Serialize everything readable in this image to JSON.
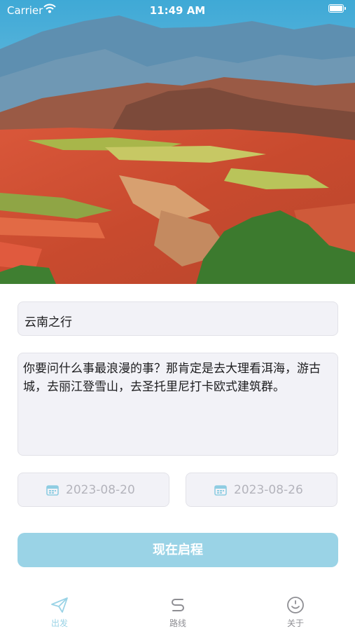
{
  "status_bar": {
    "carrier": "Carrier",
    "time": "11:49 AM"
  },
  "form": {
    "title_value": "云南之行",
    "description_value": "你要问什么事最浪漫的事？那肯定是去大理看洱海，游古城，去丽江登雪山，去圣托里尼打卡欧式建筑群。",
    "start_date": "2023-08-20",
    "end_date": "2023-08-26",
    "submit_label": "现在启程"
  },
  "tabbar": {
    "items": [
      {
        "label": "出发",
        "icon": "paper-plane-icon",
        "active": true
      },
      {
        "label": "路线",
        "icon": "route-icon",
        "active": false
      },
      {
        "label": "关于",
        "icon": "smiley-icon",
        "active": false
      }
    ]
  },
  "colors": {
    "accent": "#9ad3e6",
    "field_background": "#f2f2f7",
    "inactive_tab": "#8e8e93"
  }
}
